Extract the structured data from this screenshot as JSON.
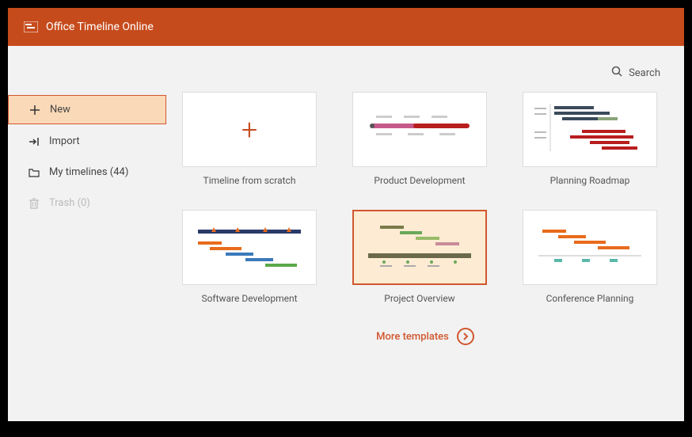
{
  "header": {
    "title": "Office Timeline Online"
  },
  "search": {
    "label": "Search"
  },
  "sidebar": {
    "items": [
      {
        "label": "New",
        "icon": "plus",
        "selected": true
      },
      {
        "label": "Import",
        "icon": "import",
        "selected": false
      },
      {
        "label": "My timelines (44)",
        "icon": "folder",
        "selected": false
      },
      {
        "label": "Trash (0)",
        "icon": "trash",
        "selected": false,
        "disabled": true
      }
    ]
  },
  "templates": [
    {
      "label": "Timeline from scratch",
      "kind": "scratch",
      "selected": false
    },
    {
      "label": "Product Development",
      "kind": "product-dev",
      "selected": false
    },
    {
      "label": "Planning Roadmap",
      "kind": "planning-roadmap",
      "selected": false
    },
    {
      "label": "Software Development",
      "kind": "software-dev",
      "selected": false
    },
    {
      "label": "Project Overview",
      "kind": "project-overview",
      "selected": true
    },
    {
      "label": "Conference Planning",
      "kind": "conference-planning",
      "selected": false
    }
  ],
  "more": {
    "label": "More templates"
  },
  "colors": {
    "brand": "#c64b1c",
    "highlight_bg": "#fad9b8",
    "highlight_border": "#d1572e"
  }
}
